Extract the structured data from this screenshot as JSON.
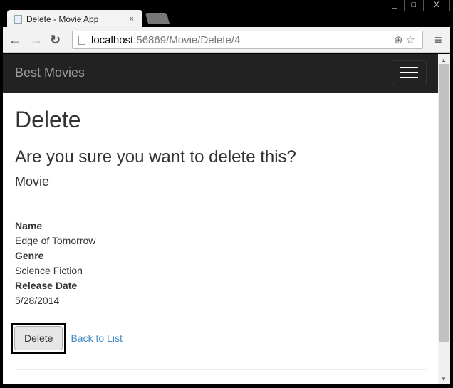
{
  "window": {
    "controls": [
      "_",
      "□",
      "X"
    ]
  },
  "tab": {
    "title": "Delete - Movie App",
    "close": "×"
  },
  "address": {
    "host": "localhost",
    "path": ":56869/Movie/Delete/4"
  },
  "navbar": {
    "brand": "Best Movies"
  },
  "page": {
    "title": "Delete",
    "question": "Are you sure you want to delete this?",
    "entity": "Movie",
    "fields": [
      {
        "label": "Name",
        "value": "Edge of Tomorrow"
      },
      {
        "label": "Genre",
        "value": "Science Fiction"
      },
      {
        "label": "Release Date",
        "value": "5/28/2014"
      }
    ],
    "delete_label": "Delete",
    "back_label": "Back to List"
  }
}
